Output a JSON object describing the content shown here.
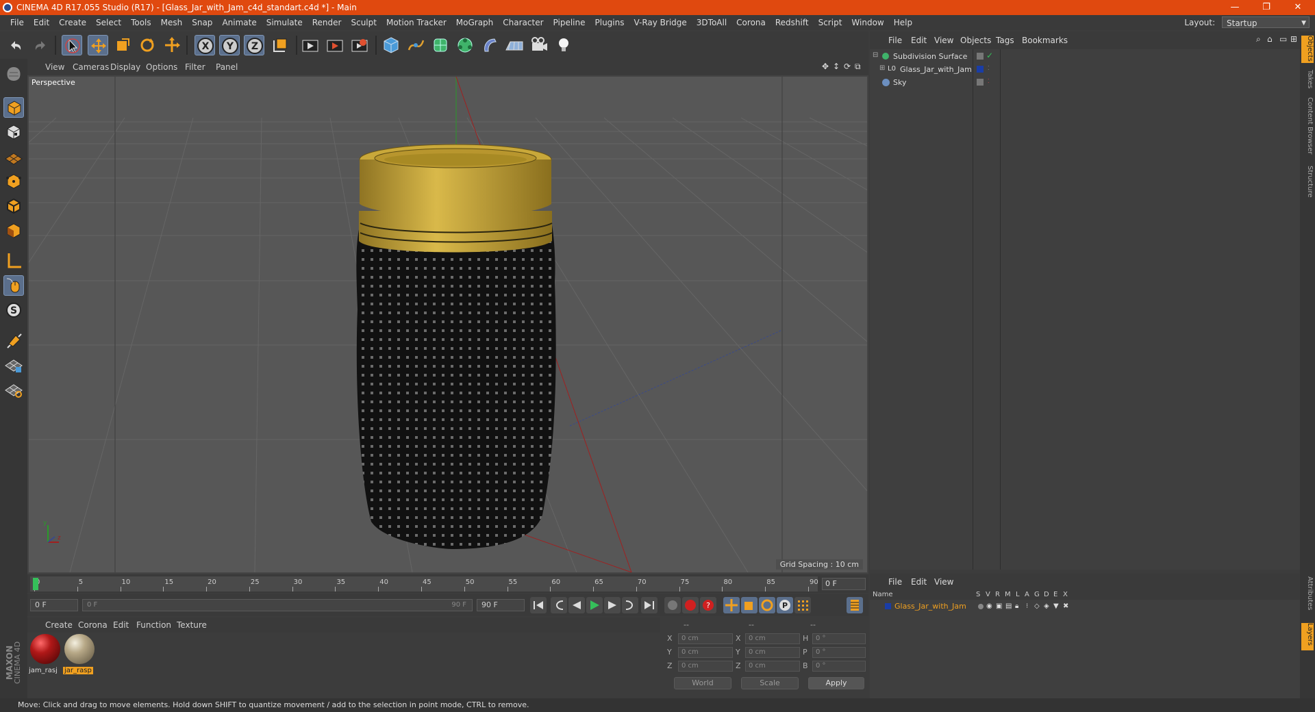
{
  "window": {
    "title": "CINEMA 4D R17.055 Studio (R17) - [Glass_Jar_with_Jam_c4d_standart.c4d *] - Main",
    "minimize": "—",
    "restore": "❐",
    "close": "✕"
  },
  "menubar": {
    "items": [
      "File",
      "Edit",
      "Create",
      "Select",
      "Tools",
      "Mesh",
      "Snap",
      "Animate",
      "Simulate",
      "Render",
      "Sculpt",
      "Motion Tracker",
      "MoGraph",
      "Character",
      "Pipeline",
      "Plugins",
      "V-Ray Bridge",
      "3DToAll",
      "Corona",
      "Redshift",
      "Script",
      "Window",
      "Help"
    ],
    "layout_label": "Layout:",
    "layout_value": "Startup"
  },
  "viewport": {
    "menu": [
      "View",
      "Cameras",
      "Display",
      "Options",
      "Filter",
      "Panel"
    ],
    "camera_label": "Perspective",
    "grid_spacing": "Grid Spacing : 10 cm",
    "axis_y": "y",
    "axis_z": "z"
  },
  "timeline": {
    "ticks": [
      "0",
      "5",
      "10",
      "15",
      "20",
      "25",
      "30",
      "35",
      "40",
      "45",
      "50",
      "55",
      "60",
      "65",
      "70",
      "75",
      "80",
      "85",
      "90"
    ],
    "frame_field": "0 F",
    "start_field": "0 F",
    "range_start": "0 F",
    "range_end": "90 F",
    "end_field": "90 F"
  },
  "materials": {
    "menu": [
      "Create",
      "Corona",
      "Edit",
      "Function",
      "Texture"
    ],
    "items": [
      {
        "name": "jam_rasj",
        "color": "#a01818"
      },
      {
        "name": "jar_rasp",
        "color": "#8a8070"
      }
    ]
  },
  "coordinates": {
    "headers": [
      "--",
      "--",
      "--"
    ],
    "rows": [
      {
        "a": "X",
        "av": "0 cm",
        "b": "X",
        "bv": "0 cm",
        "c": "H",
        "cv": "0 °"
      },
      {
        "a": "Y",
        "av": "0 cm",
        "b": "Y",
        "bv": "0 cm",
        "c": "P",
        "cv": "0 °"
      },
      {
        "a": "Z",
        "av": "0 cm",
        "b": "Z",
        "bv": "0 cm",
        "c": "B",
        "cv": "0 °"
      }
    ],
    "world": "World",
    "scale": "Scale",
    "apply": "Apply"
  },
  "objects": {
    "menu": [
      "File",
      "Edit",
      "View",
      "Objects",
      "Tags",
      "Bookmarks"
    ],
    "tree": [
      {
        "name": "Subdivision Surface",
        "color": "#3fb36a"
      },
      {
        "name": "Glass_Jar_with_Jam",
        "color": "#1a3da6"
      },
      {
        "name": "Sky",
        "color": "#6c8fc0"
      }
    ]
  },
  "layers": {
    "menu": [
      "File",
      "Edit",
      "View"
    ],
    "header_name": "Name",
    "header_cols": [
      "S",
      "V",
      "R",
      "M",
      "L",
      "A",
      "G",
      "D",
      "E",
      "X"
    ],
    "rows": [
      {
        "name": "Glass_Jar_with_Jam",
        "color": "#1a3da6"
      }
    ]
  },
  "right_tabs": [
    "Objects",
    "Takes",
    "Content Browser",
    "Structure",
    "Attributes",
    "Layers"
  ],
  "status": "Move: Click and drag to move elements. Hold down SHIFT to quantize movement / add to the selection in point mode, CTRL to remove.",
  "brand": {
    "line1": "MAXON",
    "line2": "CINEMA 4D"
  },
  "colors": {
    "accent": "#e0490f",
    "selection": "#5b6f8c",
    "lid": "#c9a83a",
    "jam": "#121212"
  }
}
